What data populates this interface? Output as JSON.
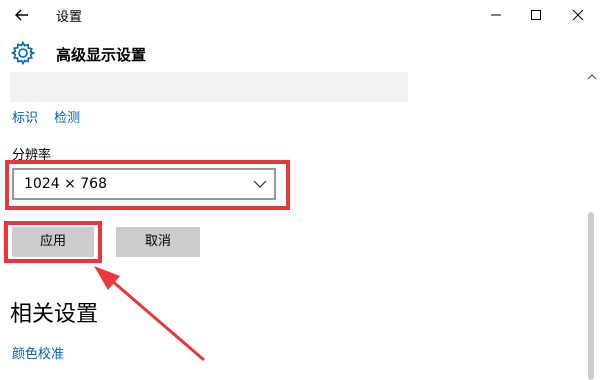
{
  "window": {
    "title": "设置"
  },
  "header": {
    "title": "高级显示设置"
  },
  "links": {
    "identify": "标识",
    "detect": "检测"
  },
  "resolution": {
    "label": "分辨率",
    "value": "1024 × 768"
  },
  "buttons": {
    "apply": "应用",
    "cancel": "取消"
  },
  "related": {
    "title": "相关设置",
    "color_calibration": "颜色校准"
  },
  "colors": {
    "highlight": "#e8383d",
    "link": "#0063b1",
    "accent": "#0063b1"
  },
  "icons": [
    "back-arrow-icon",
    "minimize-icon",
    "maximize-icon",
    "close-icon",
    "gear-icon",
    "chevron-down-icon"
  ]
}
